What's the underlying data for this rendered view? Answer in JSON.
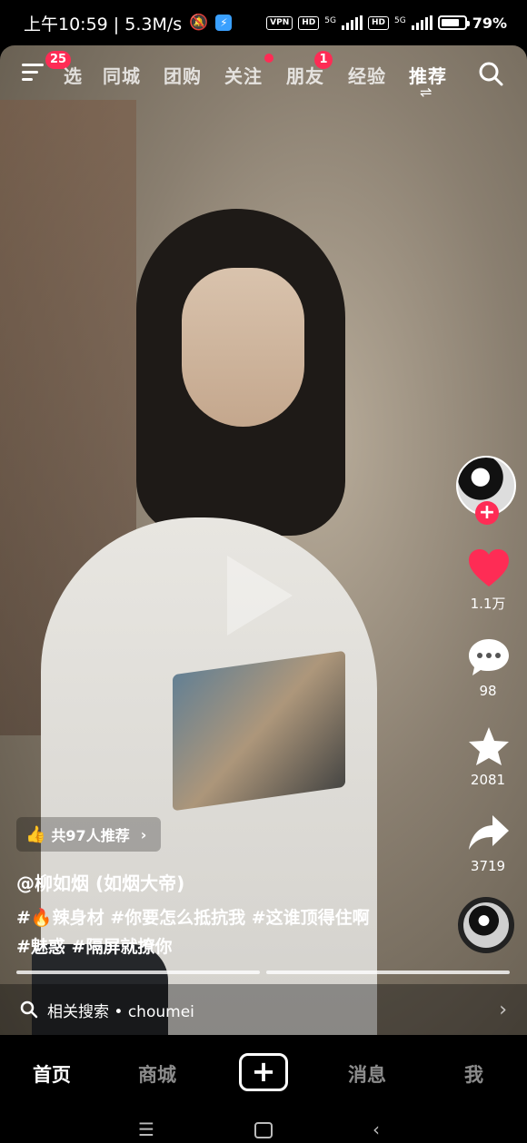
{
  "status_bar": {
    "time_text": "上午10:59 | 5.3M/s",
    "vpn_label": "VPN",
    "hd1_label": "HD",
    "net1_label": "5G",
    "hd2_label": "HD",
    "net2_label": "5G",
    "battery_percent": 79,
    "battery_text": "79%"
  },
  "top_nav": {
    "menu_badge": "25",
    "tabs": [
      "选",
      "同城",
      "团购",
      "关注",
      "朋友",
      "经验",
      "推荐"
    ],
    "friends_badge": "1",
    "active_tab": "推荐"
  },
  "video": {
    "recommend_pill": "共97人推荐",
    "author": "@柳如烟 (如烟大帝)",
    "desc_line1": "#🔥辣身材 #你要怎么抵抗我 #这谁顶得住啊",
    "desc_line2": "#魅惑 #隔屏就撩你",
    "related_search": "相关搜索 • choumei"
  },
  "rail": {
    "like_count": "1.1万",
    "comment_count": "98",
    "favorite_count": "2081",
    "share_count": "3719"
  },
  "tabbar": {
    "home": "首页",
    "mall": "商城",
    "create": "+",
    "messages": "消息",
    "me": "我"
  },
  "colors": {
    "accent": "#fe2c55",
    "background": "#000000"
  }
}
